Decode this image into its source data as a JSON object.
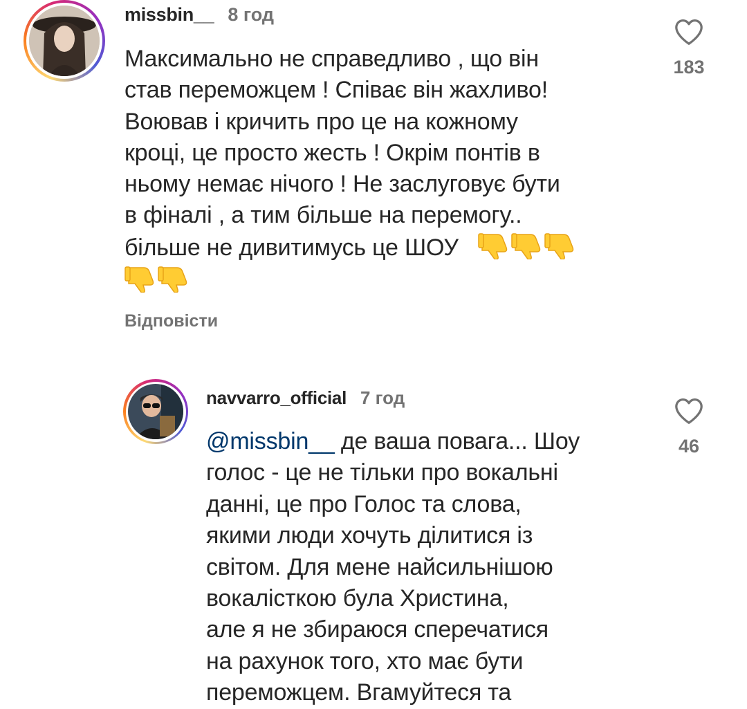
{
  "comments": [
    {
      "username": "missbin__",
      "time": "8 год",
      "lines": [
        "Максимально не справедливо , що він",
        "став переможцем ! Співає він жахливо!",
        "Воював і кричить про це на кожному",
        "кроці, це просто жесть ! Окрім понтів в",
        "ньому немає нічого ! Не заслуговує бути",
        "в фіналі , а тим більше на перемогу..",
        "більше не дивитимусь це ШОУ"
      ],
      "emoji_name": "thumbs-down-emoji",
      "emoji_count": 5,
      "likes": "183",
      "reply_label": "Відповісти"
    },
    {
      "username": "navvarro_official",
      "time": "7 год",
      "mention": "@missbin__",
      "lines": [
        " де ваша повага... Шоу",
        "голос - це не тільки про вокальні",
        "данні, це про Голос та слова,",
        "якими люди хочуть ділитися із",
        "світом. Для мене найсильнішою",
        "вокалісткою була Христина,",
        "але я не збираюся сперечатися",
        "на рахунок того, хто має бути",
        "переможцем. Вгамуйтеся та"
      ],
      "likes": "46"
    }
  ],
  "colors": {
    "text": "#262626",
    "secondary": "#737373",
    "mention": "#00376b",
    "emoji": "#FFCC33"
  }
}
